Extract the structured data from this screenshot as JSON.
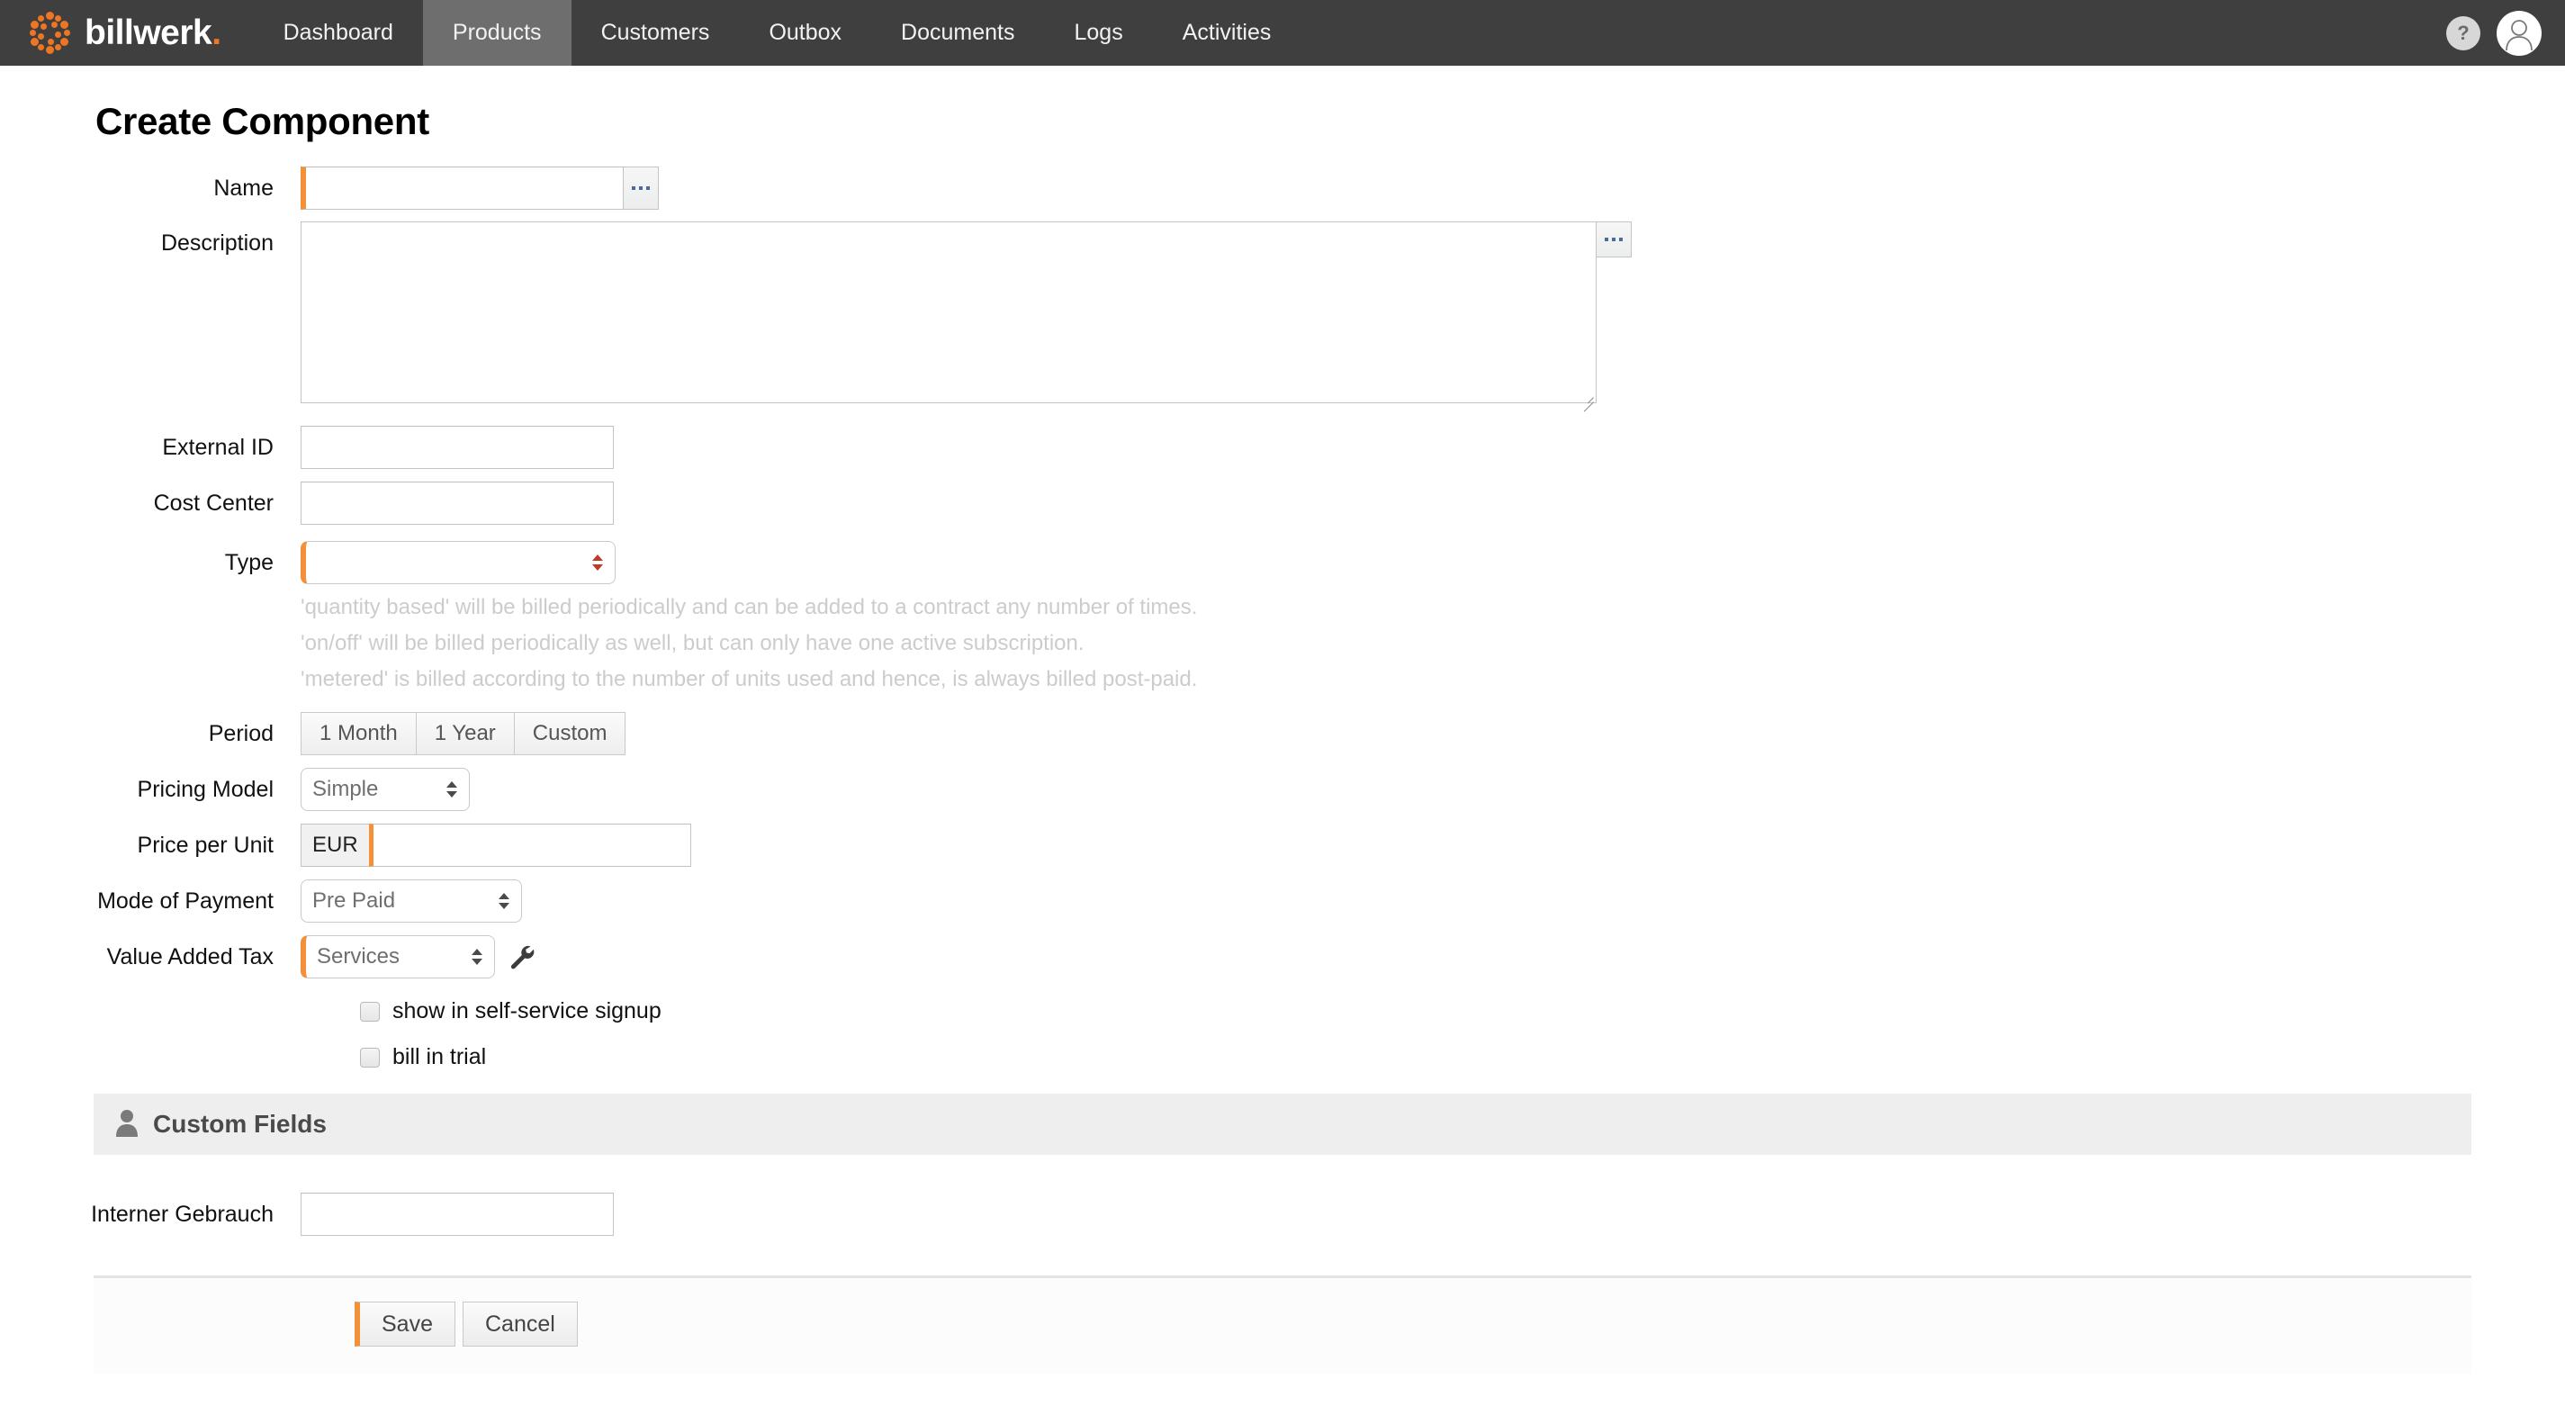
{
  "navbar": {
    "brand": "billwerk",
    "brand_dot": ".",
    "logo_icon": "billwerk-dots-logo",
    "items": [
      {
        "label": "Dashboard",
        "active": false
      },
      {
        "label": "Products",
        "active": true
      },
      {
        "label": "Customers",
        "active": false
      },
      {
        "label": "Outbox",
        "active": false
      },
      {
        "label": "Documents",
        "active": false
      },
      {
        "label": "Logs",
        "active": false
      },
      {
        "label": "Activities",
        "active": false
      }
    ],
    "help_label": "?",
    "help_icon": "question-mark-icon",
    "avatar_icon": "user-avatar-icon"
  },
  "page": {
    "title": "Create Component"
  },
  "form": {
    "name": {
      "label": "Name",
      "value": "",
      "placeholder": "",
      "required": true,
      "browse_icon": "ellipsis-icon"
    },
    "description": {
      "label": "Description",
      "value": "",
      "placeholder": "",
      "browse_icon": "ellipsis-icon",
      "resize_icon": "resize-grip-icon"
    },
    "external_id": {
      "label": "External ID",
      "value": "",
      "placeholder": ""
    },
    "cost_center": {
      "label": "Cost Center",
      "value": "",
      "placeholder": ""
    },
    "type": {
      "label": "Type",
      "value": "",
      "required": true,
      "hints": [
        "'quantity based' will be billed periodically and can be added to a contract any number of times.",
        "'on/off' will be billed periodically as well, but can only have one active subscription.",
        "'metered' is billed according to the number of units used and hence, is always billed post-paid."
      ]
    },
    "period": {
      "label": "Period",
      "options": [
        "1 Month",
        "1 Year",
        "Custom"
      ]
    },
    "pricing_model": {
      "label": "Pricing Model",
      "value": "Simple"
    },
    "price_per_unit": {
      "label": "Price per Unit",
      "currency": "EUR",
      "value": "",
      "placeholder": "",
      "required": true
    },
    "mode_of_payment": {
      "label": "Mode of Payment",
      "value": "Pre Paid"
    },
    "value_added_tax": {
      "label": "Value Added Tax",
      "value": "Services",
      "required": true,
      "settings_icon": "wrench-icon"
    },
    "show_in_signup": {
      "label": "show in self-service signup",
      "checked": false
    },
    "bill_in_trial": {
      "label": "bill in trial",
      "checked": false
    }
  },
  "custom_fields": {
    "section_title": "Custom Fields",
    "section_icon": "user-icon",
    "fields": [
      {
        "label": "Interner Gebrauch",
        "value": "",
        "placeholder": ""
      }
    ]
  },
  "actions": {
    "save_label": "Save",
    "cancel_label": "Cancel"
  },
  "colors": {
    "navbar_bg": "#3f3f3f",
    "nav_active_bg": "#6e6e6e",
    "brand_orange": "#ee7623",
    "required_accent": "#f29139",
    "hint_text": "#cccccc",
    "panel_bg": "#eeeeee"
  }
}
